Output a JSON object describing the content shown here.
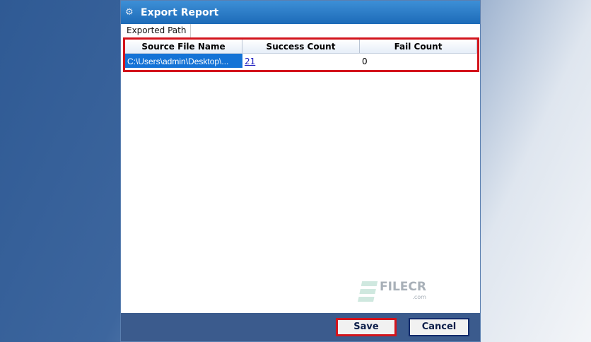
{
  "window": {
    "title": "Export Report",
    "icon": "app-logo-icon"
  },
  "tabs": [
    {
      "label": "Exported Path"
    }
  ],
  "table": {
    "headers": [
      "Source File Name",
      "Success Count",
      "Fail Count"
    ],
    "rows": [
      {
        "source": "C:\\Users\\admin\\Desktop\\...",
        "success": "21",
        "fail": "0"
      }
    ]
  },
  "watermark": {
    "text": "FILECR",
    "sub": ".com"
  },
  "buttons": {
    "save": "Save",
    "cancel": "Cancel"
  }
}
